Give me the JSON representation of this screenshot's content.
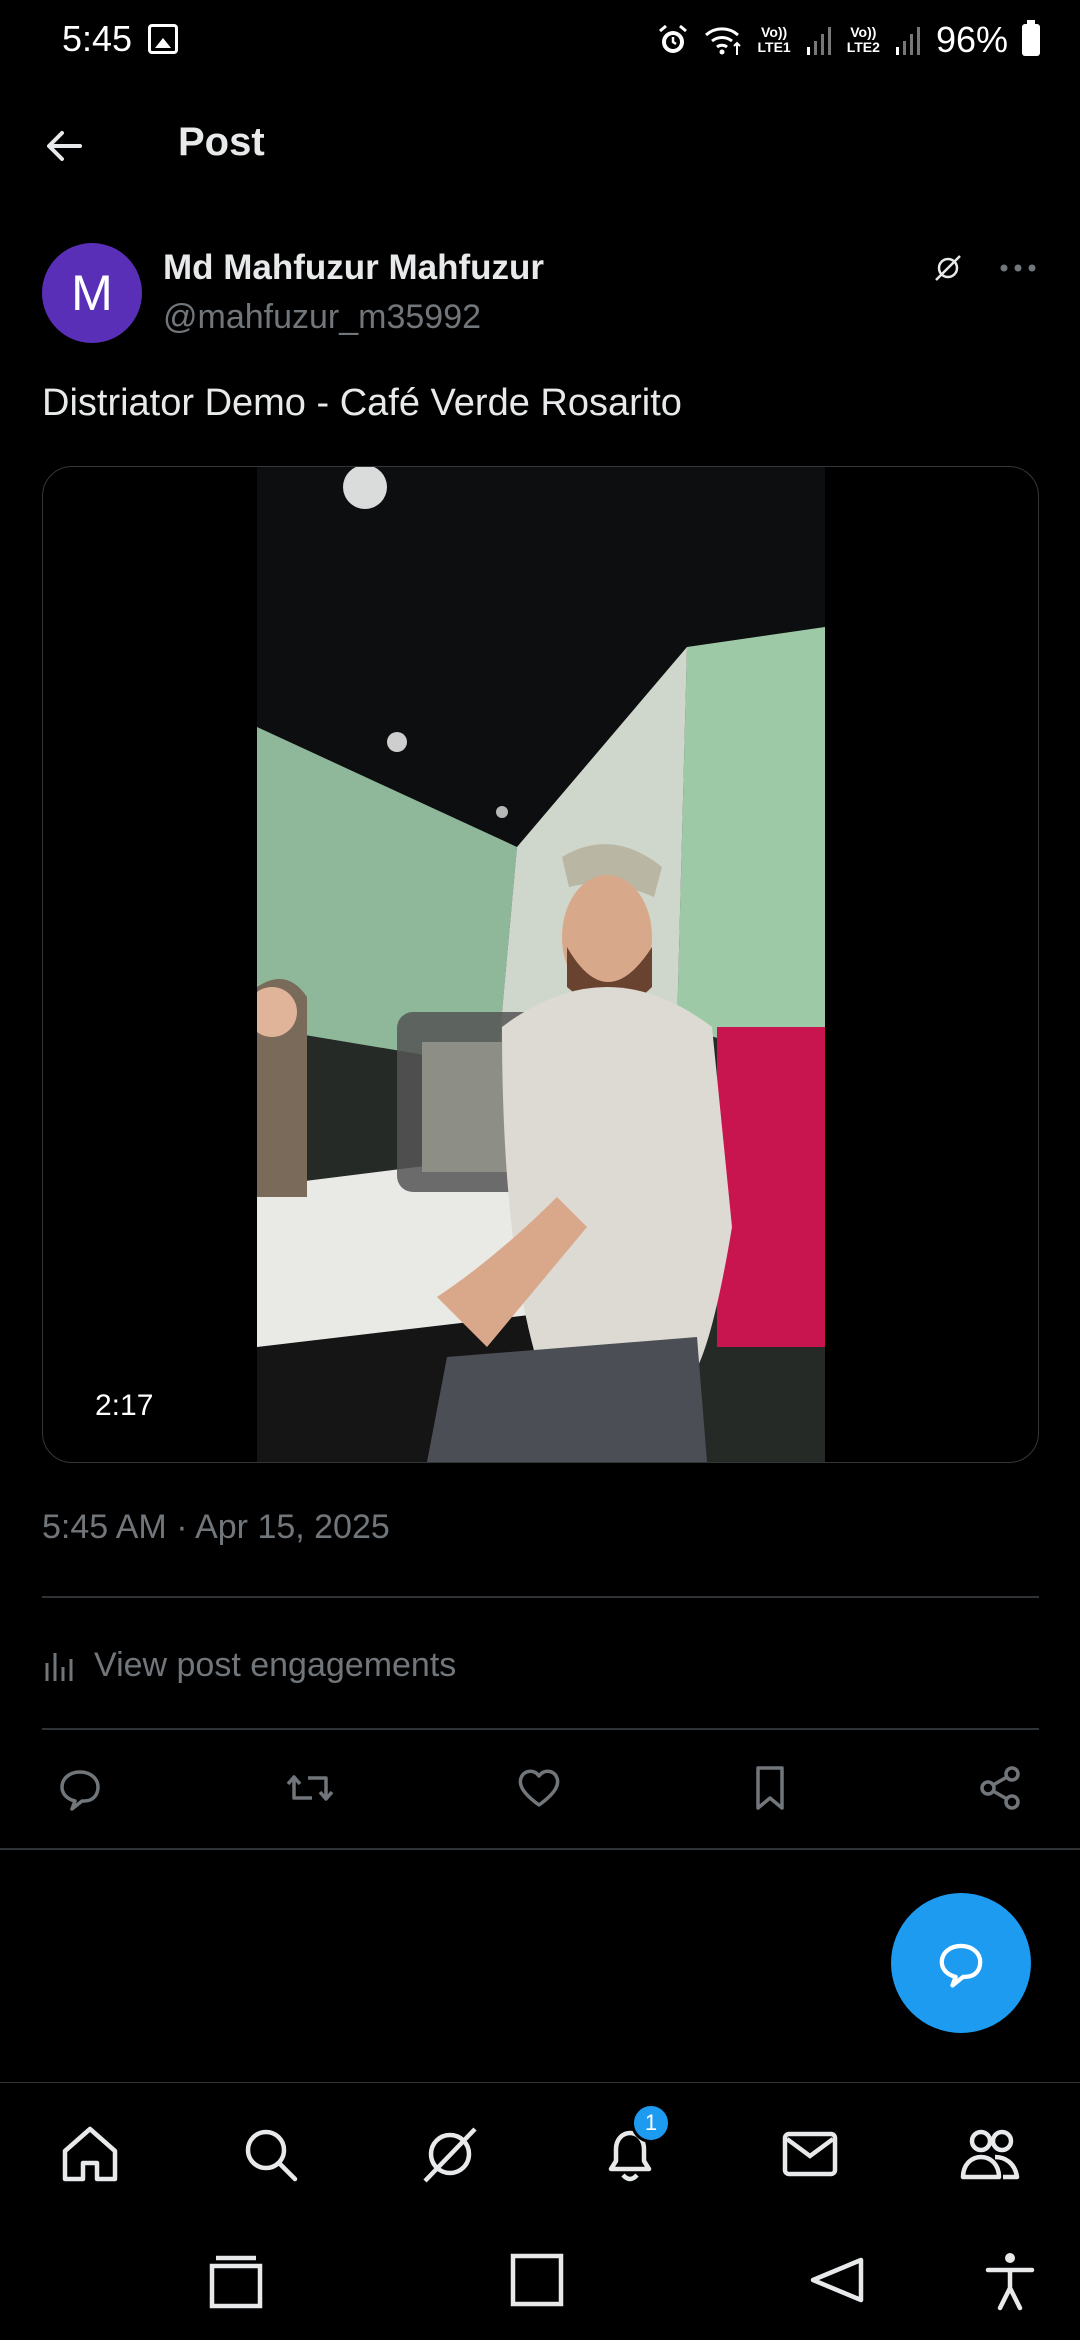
{
  "status_bar": {
    "time": "5:45",
    "lte1_top": "Vo))",
    "lte1_bottom": "LTE1",
    "lte2_top": "Vo))",
    "lte2_bottom": "LTE2",
    "battery": "96%"
  },
  "header": {
    "title": "Post"
  },
  "post": {
    "avatar_letter": "M",
    "author_name": "Md Mahfuzur Mahfuzur",
    "author_handle": "@mahfuzur_m35992",
    "text": "Distriator Demo - Café Verde Rosarito",
    "video_duration": "2:17",
    "timestamp": "5:45 AM · Apr 15, 2025",
    "engagements_label": "View post engagements"
  },
  "nav": {
    "notifications_badge": "1"
  },
  "colors": {
    "accent": "#1d9bf0",
    "avatar": "#5a2fb8",
    "muted": "#71767b"
  },
  "icons": [
    "back-arrow-icon",
    "grok-icon",
    "more-icon",
    "bar-chart-icon",
    "reply-icon",
    "repost-icon",
    "like-icon",
    "bookmark-icon",
    "share-icon",
    "compose-reply-icon",
    "home-icon",
    "search-icon",
    "grok-nav-icon",
    "bell-icon",
    "mail-icon",
    "communities-icon"
  ]
}
